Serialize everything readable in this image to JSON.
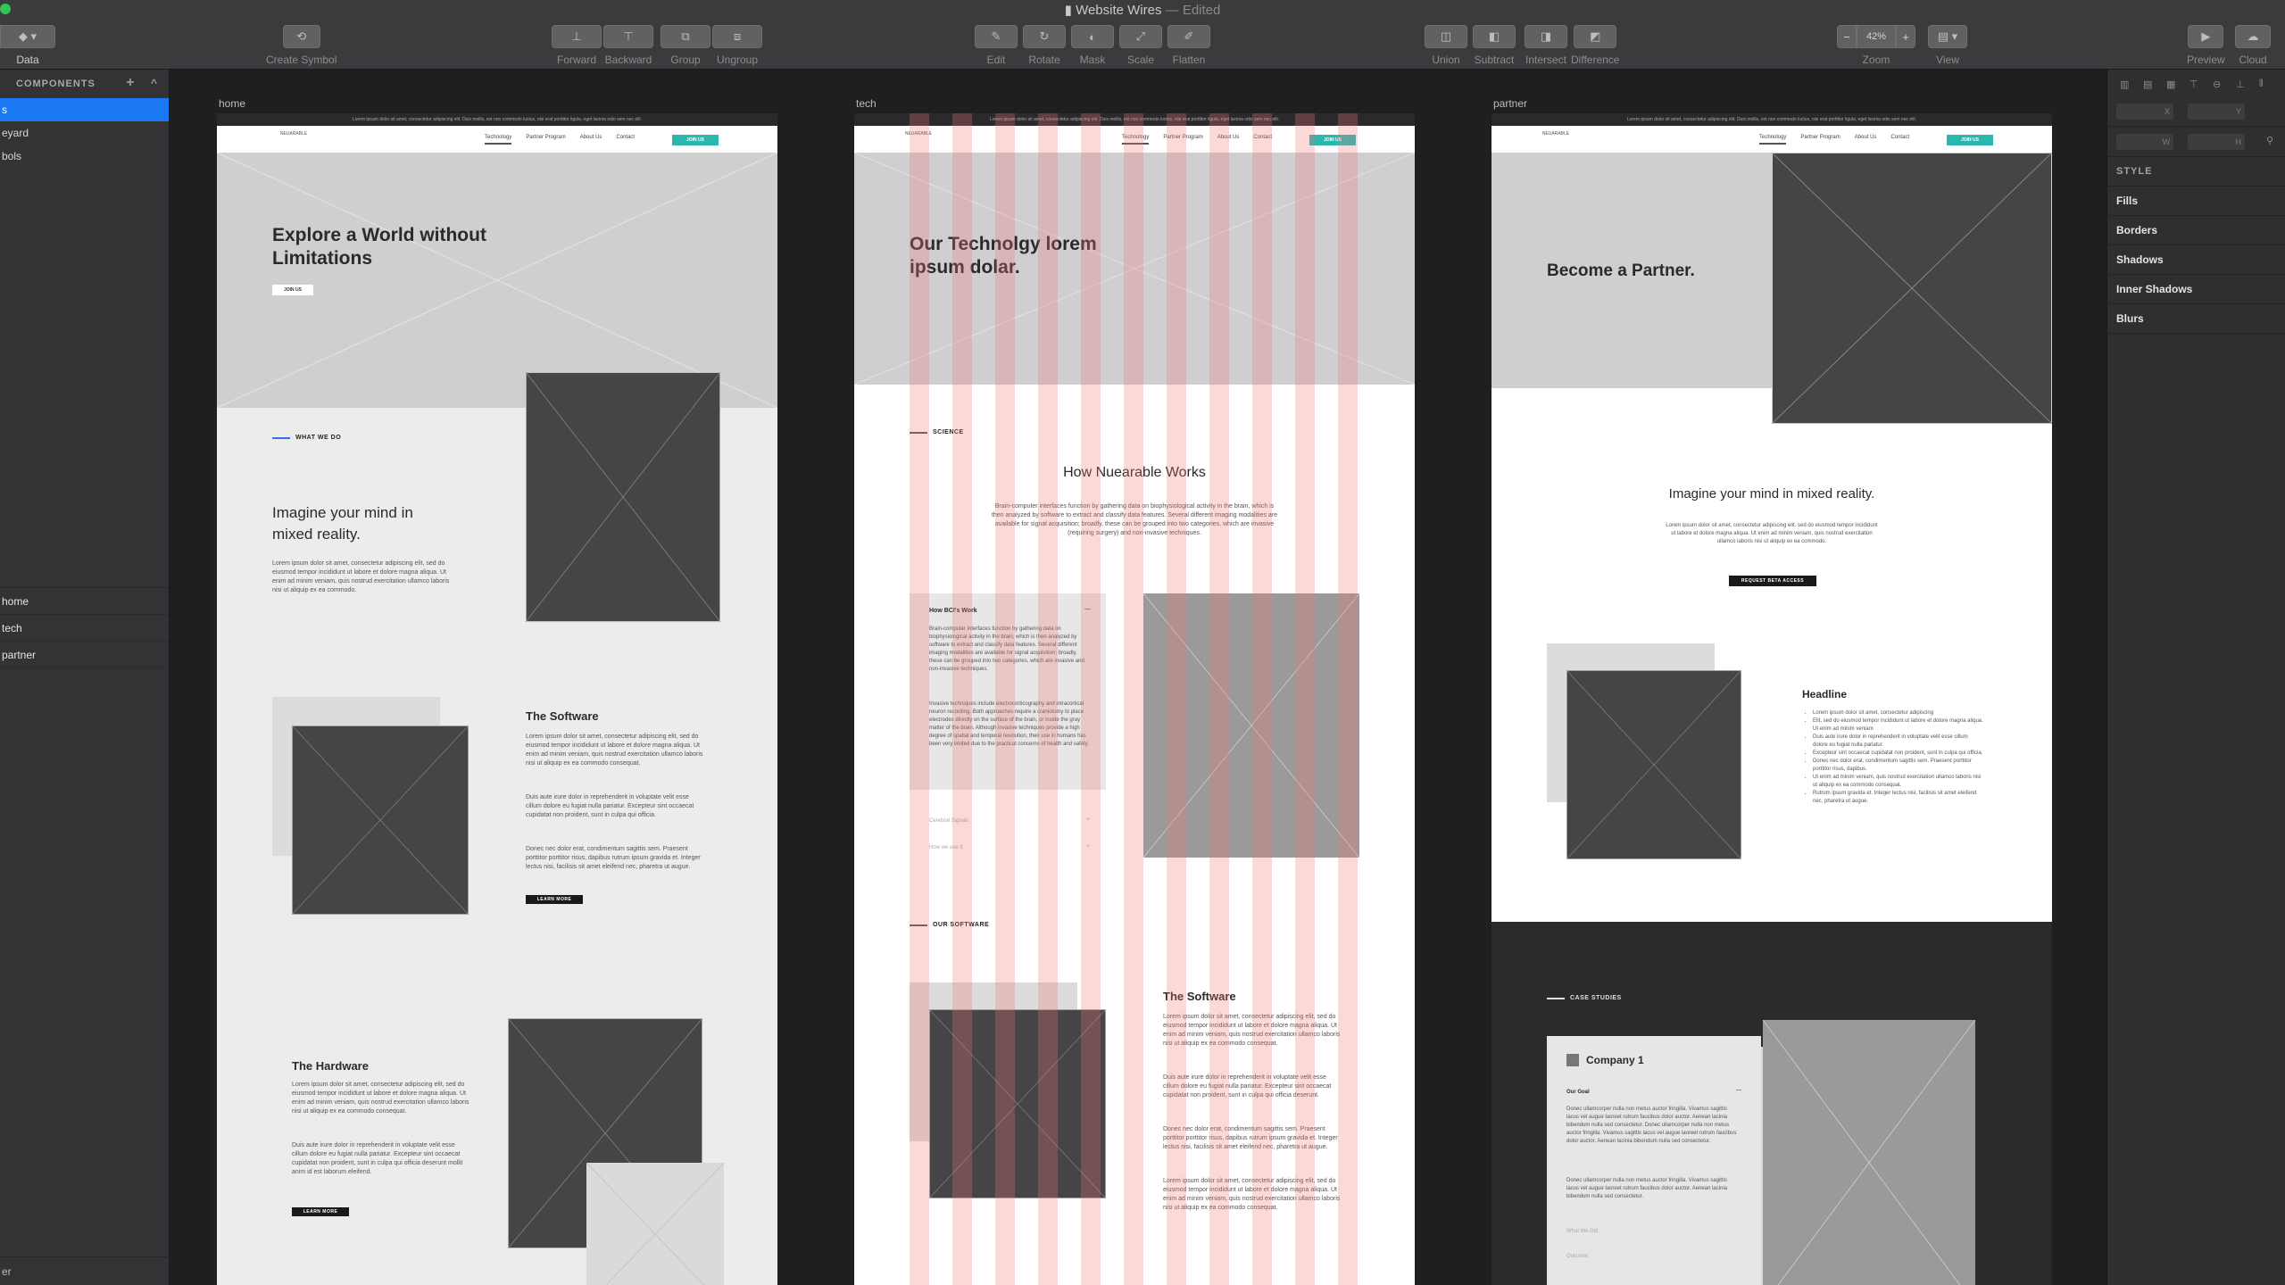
{
  "window": {
    "title": "Website Wires",
    "status": "— Edited"
  },
  "toolbar": {
    "data": "Data",
    "create_symbol": "Create Symbol",
    "forward": "Forward",
    "backward": "Backward",
    "group": "Group",
    "ungroup": "Ungroup",
    "edit": "Edit",
    "rotate": "Rotate",
    "mask": "Mask",
    "scale": "Scale",
    "flatten": "Flatten",
    "union": "Union",
    "subtract": "Subtract",
    "intersect": "Intersect",
    "difference": "Difference",
    "zoom_value": "42%",
    "zoom_minus": "−",
    "zoom_plus": "+",
    "zoom": "Zoom",
    "view": "View",
    "preview": "Preview",
    "cloud": "Cloud"
  },
  "left": {
    "header": "COMPONENTS",
    "add": "+",
    "collapse": "^",
    "rows": [
      "s",
      "eyard",
      "bols"
    ],
    "pages": [
      "home",
      "tech",
      "partner"
    ],
    "bottom": "er"
  },
  "artboards": {
    "home": {
      "label": "home",
      "topbar": "Lorem ipsum dolor sit amet, consectetur adipiscing elit. Duis mollis, est non commodo luctus, nisi erat porttitor ligula, eget lacinia odio sem nec elit.",
      "nav": {
        "logo": "NEUARABLE",
        "links": [
          "Technology",
          "Partner Program",
          "About Us",
          "Contact"
        ],
        "cta": "JOIN US"
      },
      "hero_title": "Explore a World without Limitations",
      "hero_btn": "JOIN US",
      "eyebrow": "WHAT WE DO",
      "mind_title": "Imagine your mind in mixed reality.",
      "mind_body": "Lorem ipsum dolor sit amet, consectetur adipiscing elit, sed do eiusmod tempor incididunt ut labore et dolore magna aliqua. Ut enim ad minim veniam, quis nostrud exercitation ullamco laboris nisi ut aliquip ex ea commodo.",
      "software_title": "The Software",
      "software_body1": "Lorem ipsum dolor sit amet, consectetur adipiscing elit, sed do eiusmod tempor incididunt ut labore et dolore magna aliqua. Ut enim ad minim veniam, quis nostrud exercitation ullamco laboris nisi ut aliquip ex ea commodo consequat.",
      "software_body2": "Duis aute irure dolor in reprehenderit in voluptate velit esse cillum dolore eu fugiat nulla pariatur. Excepteur sint occaecat cupidatat non proident, sunt in culpa qui officia.",
      "software_body3": "Donec nec dolor erat, condimentum sagittis sem. Praesent porttitor porttitor risus, dapibus rutrum ipsum gravida et. Integer lectus nisi, facilisis sit amet eleifend nec, pharetra ut augue.",
      "software_btn": "LEARN MORE",
      "hardware_title": "The Hardware",
      "hardware_body1": "Lorem ipsum dolor sit amet, consectetur adipiscing elit, sed do eiusmod tempor incididunt ut labore et dolore magna aliqua. Ut enim ad minim veniam, quis nostrud exercitation ullamco laboris nisi ut aliquip ex ea commodo consequat.",
      "hardware_body2": "Duis aute irure dolor in reprehenderit in voluptate velit esse cillum dolore eu fugiat nulla pariatur. Excepteur sint occaecat cupidatat non proident, sunt in culpa qui officia deserunt mollit anim id est laborum eleifend.",
      "hardware_btn": "LEARN MORE"
    },
    "tech": {
      "label": "tech",
      "topbar": "Lorem ipsum dolor sit amet, consectetur adipiscing elit. Duis mollis, est non commodo luctus, nisi erat porttitor ligula, eget lacinia odio sem nec elit.",
      "nav": {
        "logo": "NEUARABLE",
        "links": [
          "Technology",
          "Partner Program",
          "About Us",
          "Contact"
        ],
        "cta": "JOIN US"
      },
      "hero_title": "Our Technolgy lorem ipsum dolar.",
      "eyebrow": "SCIENCE",
      "how_title": "How Nuearable Works",
      "how_body": "Brain-computer interfaces function by gathering data on biophysiological activity in the brain, which is then analyzed by software to extract and classify data features. Several different imaging modalities are available for signal acquisition; broadly, these can be grouped into two categories, which are invasive (requiring surgery) and non-invasive techniques.",
      "acc_title": "How BCI's Work",
      "acc_toggle": "—",
      "acc_body1": "Brain-computer interfaces function by gathering data on biophysiological activity in the brain, which is then analyzed by software to extract and classify data features. Several different imaging modalities are available for signal acquisition; broadly, these can be grouped into two categories, which are invasive and non-invasive techniques.",
      "acc_body2": "Invasive techniques include electrocorticography and intracortical neuron recording. Both approaches require a craniotomy to place electrodes directly on the surface of the brain, or inside the gray matter of the brain. Although invasive techniques provide a high degree of spatial and temporal resolution, their use in humans has been very limited due to the practical concerns of health and safety.",
      "acc_item2": "Cerebral Signals",
      "acc_item3": "How we use it",
      "acc_plus": "+",
      "eyebrow2": "OUR SOFTWARE",
      "software_title": "The Software",
      "software_body1": "Lorem ipsum dolor sit amet, consectetur adipiscing elit, sed do eiusmod tempor incididunt ut labore et dolore magna aliqua. Ut enim ad minim veniam, quis nostrud exercitation ullamco laboris nisi ut aliquip ex ea commodo consequat.",
      "software_body2": "Duis aute irure dolor in reprehenderit in voluptate velit esse cillum dolore eu fugiat nulla pariatur. Excepteur sint occaecat cupidatat non proident, sunt in culpa qui officia deserunt.",
      "software_body3": "Donec nec dolor erat, condimentum sagittis sem. Praesent porttitor porttitor risus, dapibus rutrum ipsum gravida et. Integer lectus nisi, facilisis sit amet eleifend nec, pharetra ut augue.",
      "software_body4": "Lorem ipsum dolor sit amet, consectetur adipiscing elit, sed do eiusmod tempor incididunt ut labore et dolore magna aliqua. Ut enim ad minim veniam, quis nostrud exercitation ullamco laboris nisi ut aliquip ex ea commodo consequat."
    },
    "partner": {
      "label": "partner",
      "topbar": "Lorem ipsum dolor sit amet, consectetur adipiscing elit. Duis mollis, est non commodo luctus, nisi erat porttitor ligula, eget lacinia odio sem nec elit.",
      "nav": {
        "logo": "NEUARABLE",
        "links": [
          "Technology",
          "Partner Program",
          "About Us",
          "Contact"
        ],
        "cta": "JOIN US"
      },
      "hero_title": "Become a Partner.",
      "mind_title": "Imagine your mind in mixed reality.",
      "mind_body": "Lorem ipsum dolor sit amet, consectetur adipiscing elit, sed do eiusmod tempor incididunt ut labore et dolore magna aliqua. Ut enim ad minim veniam, quis nostrud exercitation ullamco laboris nisi ut aliquip ex ea commodo.",
      "beta_btn": "REQUEST BETA ACCESS",
      "headline": "Headline",
      "bullets": [
        "Lorem ipsum dolor sit amet, consectetur adipiscing",
        "Elit, sed do eiusmod tempor incididunt ut labore et dolore magna aliqua. Ut enim ad minim veniam",
        "Duis aute irure dolor in reprehenderit in voluptate velit esse cillum dolore eu fugiat nulla pariatur.",
        "Excepteur sint occaecat cupidatat non proident, sunt in culpa qui officia.",
        "Donec nec dolor erat, condimentum sagittis sem. Praesent porttitor porttitor risus, dapibus.",
        "Ut enim ad minim veniam, quis nostrud exercitation ullamco laboris nisi ut aliquip ex ea commodo consequat.",
        "Rutrum ipsum gravida et. Integer lectus nisi, facilisis sit amet eleifend nec, pharetra ut augue."
      ],
      "eyebrow": "CASE STUDIES",
      "company": "Company 1",
      "goal_title": "Our Goal",
      "goal_toggle": "—",
      "goal_body1": "Donec ullamcorper nulla non metus auctor fringilla. Vivamus sagittis lacus vel augue laoreet rutrum faucibus dolor auctor. Aenean lacinia bibendum nulla sed consectetur. Donec ullamcorper nulla non metus auctor fringilla. Vivamus sagittis lacus vel augue laoreet rutrum faucibus dolor auctor. Aenean lacinia bibendum nulla sed consectetur.",
      "goal_body2": "Donec ullamcorper nulla non metus auctor fringilla. Vivamus sagittis lacus vel augue laoreet rutrum faucibus dolor auctor. Aenean lacinia bibendum nulla sed consectetur.",
      "acc_item2": "What We Did",
      "acc_item3": "Outcome"
    }
  },
  "right": {
    "fld_x": "X",
    "fld_y": "Y",
    "fld_w": "W",
    "fld_h": "H",
    "style": "STYLE",
    "sections": [
      "Fills",
      "Borders",
      "Shadows",
      "Inner Shadows",
      "Blurs"
    ]
  },
  "colors": {
    "selection": "#1a78f2",
    "accent_teal": "#2bb7b0",
    "accent_blue": "#3a6ee8",
    "grid_overlay": "#f07878"
  }
}
